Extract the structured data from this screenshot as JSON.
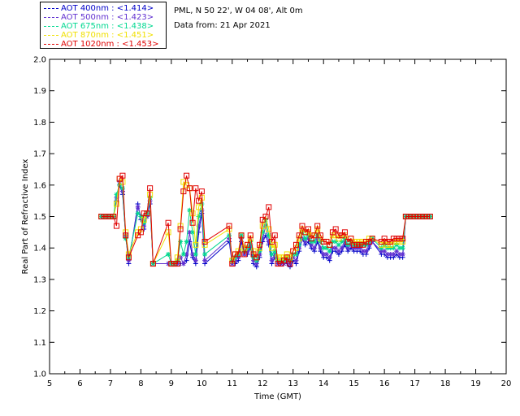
{
  "chart_data": {
    "type": "line",
    "location_text": "PML, N 50 22', W 04 08', Alt 0m",
    "date_text": "Data from: 21 Apr 2021",
    "xlabel": "Time (GMT)",
    "ylabel": "Real Part of Refractive Index",
    "xlim": [
      5,
      20
    ],
    "ylim": [
      1.0,
      2.0
    ],
    "xticks": [
      "5",
      "6",
      "7",
      "8",
      "9",
      "10",
      "11",
      "12",
      "13",
      "14",
      "15",
      "16",
      "17",
      "18",
      "19",
      "20"
    ],
    "yticks": [
      "1.0",
      "1.1",
      "1.2",
      "1.3",
      "1.4",
      "1.5",
      "1.6",
      "1.7",
      "1.8",
      "1.9",
      "2.0"
    ],
    "grid": false,
    "legend_position": "top-left",
    "series": [
      {
        "name": "AOT  400nm : <1.414>",
        "color": "#0000c8",
        "marker": "plus",
        "x": [
          6.7,
          6.8,
          6.9,
          7.0,
          7.1,
          7.2,
          7.3,
          7.4,
          7.5,
          7.6,
          7.9,
          8.0,
          8.1,
          8.2,
          8.3,
          8.4,
          8.9,
          9.0,
          9.1,
          9.2,
          9.3,
          9.4,
          9.5,
          9.6,
          9.7,
          9.8,
          9.9,
          10.0,
          10.1,
          10.9,
          11.0,
          11.1,
          11.2,
          11.3,
          11.4,
          11.5,
          11.6,
          11.7,
          11.8,
          11.9,
          12.0,
          12.1,
          12.2,
          12.3,
          12.4,
          12.5,
          12.6,
          12.7,
          12.8,
          12.9,
          13.0,
          13.1,
          13.2,
          13.3,
          13.4,
          13.5,
          13.6,
          13.7,
          13.8,
          13.9,
          14.0,
          14.1,
          14.2,
          14.3,
          14.4,
          14.5,
          14.6,
          14.7,
          14.8,
          14.9,
          15.0,
          15.1,
          15.2,
          15.3,
          15.4,
          15.5,
          15.6,
          15.9,
          16.0,
          16.1,
          16.2,
          16.3,
          16.4,
          16.5,
          16.6,
          16.7,
          16.8,
          16.9,
          17.0,
          17.1,
          17.2,
          17.3,
          17.4,
          17.5
        ],
        "y": [
          1.5,
          1.5,
          1.5,
          1.5,
          1.5,
          1.55,
          1.6,
          1.57,
          1.44,
          1.35,
          1.54,
          1.49,
          1.46,
          1.5,
          1.54,
          1.35,
          1.35,
          1.35,
          1.35,
          1.35,
          1.35,
          1.35,
          1.36,
          1.42,
          1.37,
          1.35,
          1.45,
          1.51,
          1.35,
          1.42,
          1.35,
          1.35,
          1.36,
          1.42,
          1.38,
          1.38,
          1.4,
          1.35,
          1.34,
          1.37,
          1.42,
          1.44,
          1.41,
          1.35,
          1.37,
          1.35,
          1.35,
          1.35,
          1.35,
          1.34,
          1.36,
          1.35,
          1.39,
          1.43,
          1.41,
          1.42,
          1.4,
          1.39,
          1.42,
          1.39,
          1.37,
          1.37,
          1.36,
          1.39,
          1.39,
          1.38,
          1.39,
          1.41,
          1.39,
          1.4,
          1.39,
          1.39,
          1.39,
          1.38,
          1.38,
          1.4,
          1.42,
          1.38,
          1.38,
          1.37,
          1.37,
          1.37,
          1.38,
          1.37,
          1.37,
          1.5,
          1.5,
          1.5,
          1.5,
          1.5,
          1.5,
          1.5,
          1.5,
          1.5
        ]
      },
      {
        "name": "AOT  500nm : <1.423>",
        "color": "#6030d0",
        "marker": "star",
        "x": [
          6.7,
          6.8,
          6.9,
          7.0,
          7.1,
          7.2,
          7.3,
          7.4,
          7.5,
          7.6,
          7.9,
          8.0,
          8.1,
          8.2,
          8.3,
          8.4,
          8.9,
          9.0,
          9.1,
          9.2,
          9.3,
          9.4,
          9.5,
          9.6,
          9.7,
          9.8,
          9.9,
          10.0,
          10.1,
          10.9,
          11.0,
          11.1,
          11.2,
          11.3,
          11.4,
          11.5,
          11.6,
          11.7,
          11.8,
          11.9,
          12.0,
          12.1,
          12.2,
          12.3,
          12.4,
          12.5,
          12.6,
          12.7,
          12.8,
          12.9,
          13.0,
          13.1,
          13.2,
          13.3,
          13.4,
          13.5,
          13.6,
          13.7,
          13.8,
          13.9,
          14.0,
          14.1,
          14.2,
          14.3,
          14.4,
          14.5,
          14.6,
          14.7,
          14.8,
          14.9,
          15.0,
          15.1,
          15.2,
          15.3,
          15.4,
          15.5,
          15.6,
          15.9,
          16.0,
          16.1,
          16.2,
          16.3,
          16.4,
          16.5,
          16.6,
          16.7,
          16.8,
          16.9,
          17.0,
          17.1,
          17.2,
          17.3,
          17.4,
          17.5
        ],
        "y": [
          1.5,
          1.5,
          1.5,
          1.5,
          1.5,
          1.56,
          1.61,
          1.58,
          1.44,
          1.36,
          1.53,
          1.5,
          1.47,
          1.5,
          1.55,
          1.35,
          1.35,
          1.35,
          1.35,
          1.35,
          1.37,
          1.35,
          1.38,
          1.45,
          1.38,
          1.36,
          1.47,
          1.52,
          1.36,
          1.43,
          1.35,
          1.36,
          1.37,
          1.43,
          1.38,
          1.39,
          1.41,
          1.36,
          1.35,
          1.38,
          1.43,
          1.47,
          1.42,
          1.36,
          1.38,
          1.35,
          1.35,
          1.35,
          1.36,
          1.35,
          1.37,
          1.36,
          1.4,
          1.43,
          1.42,
          1.43,
          1.41,
          1.4,
          1.43,
          1.4,
          1.38,
          1.38,
          1.37,
          1.4,
          1.4,
          1.39,
          1.4,
          1.42,
          1.4,
          1.41,
          1.4,
          1.4,
          1.4,
          1.39,
          1.39,
          1.41,
          1.42,
          1.39,
          1.39,
          1.38,
          1.38,
          1.38,
          1.39,
          1.38,
          1.38,
          1.5,
          1.5,
          1.5,
          1.5,
          1.5,
          1.5,
          1.5,
          1.5,
          1.5
        ]
      },
      {
        "name": "AOT  675nm : <1.438>",
        "color": "#00d890",
        "marker": "star",
        "x": [
          6.7,
          6.8,
          6.9,
          7.0,
          7.1,
          7.2,
          7.3,
          7.4,
          7.5,
          7.6,
          7.9,
          8.0,
          8.1,
          8.2,
          8.3,
          8.4,
          8.9,
          9.0,
          9.1,
          9.2,
          9.3,
          9.4,
          9.5,
          9.6,
          9.7,
          9.8,
          9.9,
          10.0,
          10.1,
          10.9,
          11.0,
          11.1,
          11.2,
          11.3,
          11.4,
          11.5,
          11.6,
          11.7,
          11.8,
          11.9,
          12.0,
          12.1,
          12.2,
          12.3,
          12.4,
          12.5,
          12.6,
          12.7,
          12.8,
          12.9,
          13.0,
          13.1,
          13.2,
          13.3,
          13.4,
          13.5,
          13.6,
          13.7,
          13.8,
          13.9,
          14.0,
          14.1,
          14.2,
          14.3,
          14.4,
          14.5,
          14.6,
          14.7,
          14.8,
          14.9,
          15.0,
          15.1,
          15.2,
          15.3,
          15.4,
          15.5,
          15.6,
          15.9,
          16.0,
          16.1,
          16.2,
          16.3,
          16.4,
          16.5,
          16.6,
          16.7,
          16.8,
          16.9,
          17.0,
          17.1,
          17.2,
          17.3,
          17.4,
          17.5
        ],
        "y": [
          1.5,
          1.5,
          1.5,
          1.5,
          1.5,
          1.57,
          1.6,
          1.59,
          1.43,
          1.37,
          1.51,
          1.5,
          1.48,
          1.51,
          1.56,
          1.35,
          1.38,
          1.35,
          1.35,
          1.36,
          1.42,
          1.38,
          1.42,
          1.52,
          1.45,
          1.38,
          1.5,
          1.54,
          1.38,
          1.44,
          1.36,
          1.37,
          1.38,
          1.44,
          1.39,
          1.4,
          1.42,
          1.37,
          1.36,
          1.39,
          1.45,
          1.49,
          1.44,
          1.38,
          1.39,
          1.36,
          1.36,
          1.36,
          1.37,
          1.36,
          1.38,
          1.38,
          1.41,
          1.45,
          1.43,
          1.44,
          1.42,
          1.42,
          1.44,
          1.42,
          1.4,
          1.4,
          1.39,
          1.42,
          1.42,
          1.41,
          1.42,
          1.43,
          1.41,
          1.42,
          1.41,
          1.41,
          1.41,
          1.41,
          1.41,
          1.42,
          1.43,
          1.4,
          1.41,
          1.4,
          1.4,
          1.4,
          1.41,
          1.4,
          1.4,
          1.5,
          1.5,
          1.5,
          1.5,
          1.5,
          1.5,
          1.5,
          1.5,
          1.5
        ]
      },
      {
        "name": "AOT  870nm : <1.451>",
        "color": "#f0e000",
        "marker": "square",
        "x": [
          6.7,
          6.8,
          6.9,
          7.0,
          7.1,
          7.2,
          7.3,
          7.4,
          7.5,
          7.6,
          7.9,
          8.0,
          8.1,
          8.2,
          8.3,
          8.4,
          8.9,
          9.0,
          9.1,
          9.2,
          9.3,
          9.4,
          9.5,
          9.6,
          9.7,
          9.8,
          9.9,
          10.0,
          10.1,
          10.9,
          11.0,
          11.1,
          11.2,
          11.3,
          11.4,
          11.5,
          11.6,
          11.7,
          11.8,
          11.9,
          12.0,
          12.1,
          12.2,
          12.3,
          12.4,
          12.5,
          12.6,
          12.7,
          12.8,
          12.9,
          13.0,
          13.1,
          13.2,
          13.3,
          13.4,
          13.5,
          13.6,
          13.7,
          13.8,
          13.9,
          14.0,
          14.1,
          14.2,
          14.3,
          14.4,
          14.5,
          14.6,
          14.7,
          14.8,
          14.9,
          15.0,
          15.1,
          15.2,
          15.3,
          15.4,
          15.5,
          15.6,
          15.9,
          16.0,
          16.1,
          16.2,
          16.3,
          16.4,
          16.5,
          16.6,
          16.7,
          16.8,
          16.9,
          17.0,
          17.1,
          17.2,
          17.3,
          17.4,
          17.5
        ],
        "y": [
          1.5,
          1.5,
          1.5,
          1.5,
          1.5,
          1.54,
          1.62,
          1.61,
          1.45,
          1.38,
          1.45,
          1.46,
          1.49,
          1.51,
          1.57,
          1.35,
          1.45,
          1.35,
          1.35,
          1.37,
          1.47,
          1.61,
          1.6,
          1.59,
          1.51,
          1.41,
          1.53,
          1.56,
          1.41,
          1.46,
          1.36,
          1.38,
          1.39,
          1.44,
          1.4,
          1.41,
          1.43,
          1.39,
          1.37,
          1.4,
          1.47,
          1.5,
          1.46,
          1.4,
          1.41,
          1.37,
          1.37,
          1.37,
          1.38,
          1.37,
          1.39,
          1.4,
          1.43,
          1.46,
          1.45,
          1.45,
          1.44,
          1.44,
          1.46,
          1.43,
          1.42,
          1.42,
          1.41,
          1.44,
          1.44,
          1.43,
          1.44,
          1.44,
          1.42,
          1.43,
          1.42,
          1.42,
          1.42,
          1.42,
          1.42,
          1.43,
          1.43,
          1.41,
          1.42,
          1.41,
          1.41,
          1.42,
          1.42,
          1.42,
          1.42,
          1.5,
          1.5,
          1.5,
          1.5,
          1.5,
          1.5,
          1.5,
          1.5,
          1.5
        ]
      },
      {
        "name": "AOT 1020nm : <1.453>",
        "color": "#e00000",
        "marker": "square",
        "x": [
          6.7,
          6.8,
          6.9,
          7.0,
          7.1,
          7.2,
          7.3,
          7.4,
          7.5,
          7.6,
          7.9,
          8.0,
          8.1,
          8.2,
          8.3,
          8.4,
          8.9,
          9.0,
          9.1,
          9.2,
          9.3,
          9.4,
          9.5,
          9.6,
          9.7,
          9.8,
          9.9,
          10.0,
          10.1,
          10.9,
          11.0,
          11.1,
          11.2,
          11.3,
          11.4,
          11.5,
          11.6,
          11.7,
          11.8,
          11.9,
          12.0,
          12.1,
          12.2,
          12.3,
          12.4,
          12.5,
          12.6,
          12.7,
          12.8,
          12.9,
          13.0,
          13.1,
          13.2,
          13.3,
          13.4,
          13.5,
          13.6,
          13.7,
          13.8,
          13.9,
          14.0,
          14.1,
          14.2,
          14.3,
          14.4,
          14.5,
          14.6,
          14.7,
          14.8,
          14.9,
          15.0,
          15.1,
          15.2,
          15.3,
          15.4,
          15.5,
          15.6,
          15.9,
          16.0,
          16.1,
          16.2,
          16.3,
          16.4,
          16.5,
          16.6,
          16.7,
          16.8,
          16.9,
          17.0,
          17.1,
          17.2,
          17.3,
          17.4,
          17.5
        ],
        "y": [
          1.5,
          1.5,
          1.5,
          1.5,
          1.5,
          1.47,
          1.62,
          1.63,
          1.44,
          1.37,
          1.44,
          1.45,
          1.51,
          1.51,
          1.59,
          1.35,
          1.48,
          1.35,
          1.35,
          1.35,
          1.46,
          1.58,
          1.63,
          1.59,
          1.48,
          1.59,
          1.55,
          1.58,
          1.42,
          1.47,
          1.35,
          1.38,
          1.38,
          1.44,
          1.38,
          1.41,
          1.44,
          1.38,
          1.37,
          1.41,
          1.49,
          1.5,
          1.53,
          1.42,
          1.44,
          1.35,
          1.35,
          1.36,
          1.37,
          1.35,
          1.39,
          1.41,
          1.44,
          1.47,
          1.45,
          1.46,
          1.43,
          1.44,
          1.47,
          1.44,
          1.42,
          1.42,
          1.41,
          1.45,
          1.46,
          1.44,
          1.44,
          1.45,
          1.42,
          1.43,
          1.41,
          1.41,
          1.41,
          1.41,
          1.42,
          1.42,
          1.43,
          1.42,
          1.43,
          1.42,
          1.42,
          1.43,
          1.43,
          1.43,
          1.43,
          1.5,
          1.5,
          1.5,
          1.5,
          1.5,
          1.5,
          1.5,
          1.5,
          1.5
        ]
      }
    ]
  }
}
